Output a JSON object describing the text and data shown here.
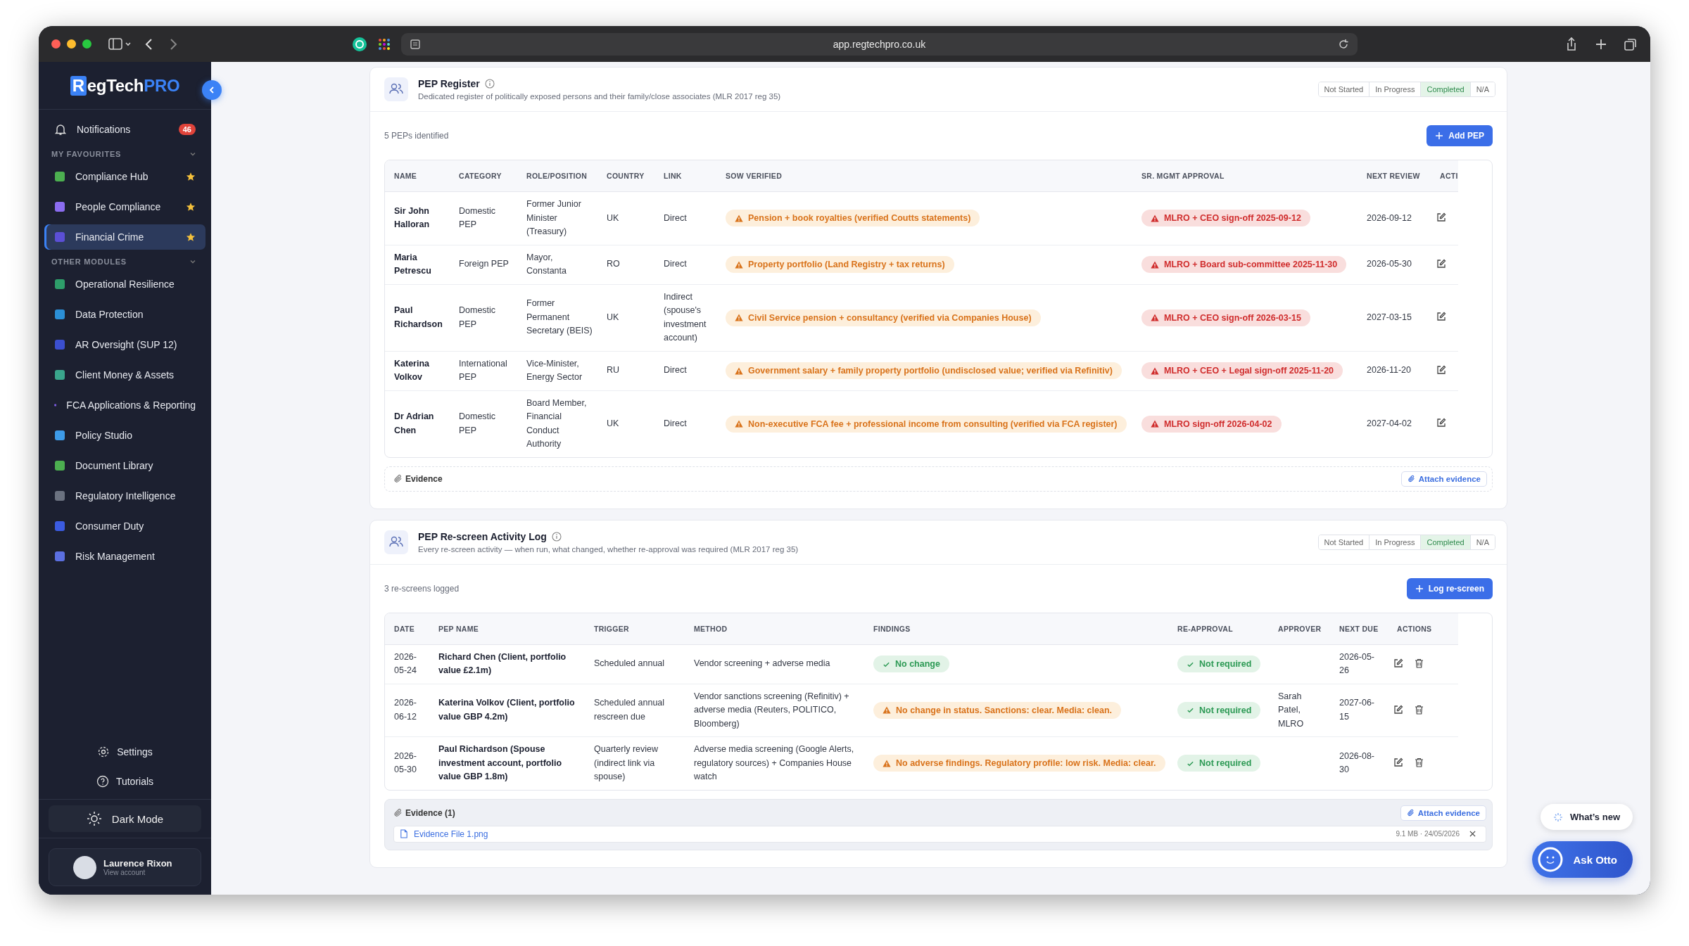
{
  "browser": {
    "url": "app.regtechpro.co.uk"
  },
  "sidebar": {
    "logo": {
      "mark": "R",
      "text": "egTech",
      "accent": "PRO"
    },
    "notifications": {
      "label": "Notifications",
      "count": "46"
    },
    "sections": [
      {
        "title": "MY FAVOURITES",
        "expanded": true,
        "items": [
          {
            "label": "Compliance Hub",
            "color": "#4caf50",
            "starred": true,
            "selected": false
          },
          {
            "label": "People Compliance",
            "color": "#8b6cf0",
            "starred": true,
            "selected": false
          },
          {
            "label": "Financial Crime",
            "color": "#5b4fd6",
            "starred": true,
            "selected": true
          }
        ]
      },
      {
        "title": "OTHER MODULES",
        "expanded": true,
        "items": [
          {
            "label": "Operational Resilience",
            "color": "#2e9e6a",
            "starred": false,
            "selected": false
          },
          {
            "label": "Data Protection",
            "color": "#2b8fd6",
            "starred": false,
            "selected": false
          },
          {
            "label": "AR Oversight (SUP 12)",
            "color": "#3b4fd0",
            "starred": false,
            "selected": false
          },
          {
            "label": "Client Money & Assets",
            "color": "#3aa58c",
            "starred": false,
            "selected": false
          },
          {
            "label": "FCA Applications & Reporting",
            "color": "#7b5be0",
            "starred": false,
            "selected": false
          },
          {
            "label": "Policy Studio",
            "color": "#3d9be9",
            "starred": false,
            "selected": false
          },
          {
            "label": "Document Library",
            "color": "#4caf50",
            "starred": false,
            "selected": false
          },
          {
            "label": "Regulatory Intelligence",
            "color": "#6b7280",
            "starred": false,
            "selected": false
          },
          {
            "label": "Consumer Duty",
            "color": "#3b5be0",
            "starred": false,
            "selected": false
          },
          {
            "label": "Risk Management",
            "color": "#5b6fe0",
            "starred": false,
            "selected": false
          }
        ]
      }
    ],
    "settings": "Settings",
    "tutorials": "Tutorials",
    "dark_mode": "Dark Mode",
    "user": {
      "name": "Laurence Rixon",
      "subtitle": "View account"
    }
  },
  "cards": [
    {
      "title": "PEP Register",
      "description": "Dedicated register of politically exposed persons and their family/close associates (MLR 2017 reg 35)",
      "status_options": [
        {
          "label": "Not Started",
          "selected": false
        },
        {
          "label": "In Progress",
          "selected": false
        },
        {
          "label": "Completed",
          "selected": true
        },
        {
          "label": "N/A",
          "selected": false
        }
      ],
      "count": "5 PEPs identified",
      "add_button": "Add PEP",
      "table": {
        "columns": [
          "NAME",
          "CATEGORY",
          "ROLE/POSITION",
          "COUNTRY",
          "LINK",
          "SOW VERIFIED",
          "SR. MGMT APPROVAL",
          "NEXT REVIEW",
          "ACTI"
        ],
        "rows": [
          {
            "cells": [
              {
                "text": "Sir John Halloran"
              },
              {
                "text": "Domestic PEP"
              },
              {
                "text": "Former Junior Minister (Treasury)"
              },
              {
                "text": "UK"
              },
              {
                "text": "Direct"
              },
              {
                "text": "Pension + book royalties (verified Coutts statements)",
                "kind": "warning"
              },
              {
                "text": "MLRO + CEO sign-off 2025-09-12",
                "kind": "danger"
              },
              {
                "text": "2026-09-12"
              }
            ],
            "actions": [
              {
                "kind": "edit"
              }
            ]
          },
          {
            "cells": [
              {
                "text": "Maria Petrescu"
              },
              {
                "text": "Foreign PEP"
              },
              {
                "text": "Mayor, Constanta"
              },
              {
                "text": "RO"
              },
              {
                "text": "Direct"
              },
              {
                "text": "Property portfolio (Land Registry + tax returns)",
                "kind": "warning"
              },
              {
                "text": "MLRO + Board sub-committee 2025-11-30",
                "kind": "danger"
              },
              {
                "text": "2026-05-30"
              }
            ],
            "actions": [
              {
                "kind": "edit"
              }
            ]
          },
          {
            "cells": [
              {
                "text": "Paul Richardson"
              },
              {
                "text": "Domestic PEP"
              },
              {
                "text": "Former Permanent Secretary (BEIS)"
              },
              {
                "text": "UK"
              },
              {
                "text": "Indirect (spouse's investment account)"
              },
              {
                "text": "Civil Service pension + consultancy (verified via Companies House)",
                "kind": "warning"
              },
              {
                "text": "MLRO + CEO sign-off 2026-03-15",
                "kind": "danger"
              },
              {
                "text": "2027-03-15"
              }
            ],
            "actions": [
              {
                "kind": "edit"
              }
            ]
          },
          {
            "cells": [
              {
                "text": "Katerina Volkov"
              },
              {
                "text": "International PEP"
              },
              {
                "text": "Vice-Minister, Energy Sector"
              },
              {
                "text": "RU"
              },
              {
                "text": "Direct"
              },
              {
                "text": "Government salary + family property portfolio (undisclosed value; verified via Refinitiv)",
                "kind": "warning"
              },
              {
                "text": "MLRO + CEO + Legal sign-off 2025-11-20",
                "kind": "danger"
              },
              {
                "text": "2026-11-20"
              }
            ],
            "actions": [
              {
                "kind": "edit"
              }
            ]
          },
          {
            "cells": [
              {
                "text": "Dr Adrian Chen"
              },
              {
                "text": "Domestic PEP"
              },
              {
                "text": "Board Member, Financial Conduct Authority"
              },
              {
                "text": "UK"
              },
              {
                "text": "Direct"
              },
              {
                "text": "Non-executive FCA fee + professional income from consulting (verified via FCA register)",
                "kind": "warning"
              },
              {
                "text": "MLRO sign-off 2026-04-02",
                "kind": "danger"
              },
              {
                "text": "2027-04-02"
              }
            ],
            "actions": [
              {
                "kind": "edit"
              }
            ]
          }
        ]
      },
      "evidence": {
        "label": "Evidence",
        "attach": "Attach evidence"
      }
    },
    {
      "title": "PEP Re-screen Activity Log",
      "description": "Every re-screen activity — when run, what changed, whether re-approval was required (MLR 2017 reg 35)",
      "status_options": [
        {
          "label": "Not Started",
          "selected": false
        },
        {
          "label": "In Progress",
          "selected": false
        },
        {
          "label": "Completed",
          "selected": true
        },
        {
          "label": "N/A",
          "selected": false
        }
      ],
      "count": "3 re-screens logged",
      "add_button": "Log re-screen",
      "table": {
        "columns": [
          "DATE",
          "PEP NAME",
          "TRIGGER",
          "METHOD",
          "FINDINGS",
          "RE-APPROVAL",
          "APPROVER",
          "NEXT DUE",
          "ACTIONS"
        ],
        "rows": [
          {
            "cells": [
              {
                "text": "2026-05-24"
              },
              {
                "text": "Richard Chen (Client, portfolio value £2.1m)"
              },
              {
                "text": "Scheduled annual"
              },
              {
                "text": "Vendor screening + adverse media"
              },
              {
                "text": "No change",
                "kind": "success"
              },
              {
                "text": "Not required",
                "kind": "success"
              },
              {},
              {
                "text": "2026-05-26"
              }
            ],
            "actions": [
              {
                "kind": "edit"
              },
              {
                "kind": "delete"
              }
            ]
          },
          {
            "cells": [
              {
                "text": "2026-06-12"
              },
              {
                "text": "Katerina Volkov (Client, portfolio value GBP 4.2m)"
              },
              {
                "text": "Scheduled annual rescreen due"
              },
              {
                "text": "Vendor sanctions screening (Refinitiv) + adverse media (Reuters, POLITICO, Bloomberg)"
              },
              {
                "text": "No change in status. Sanctions: clear. Media: clean.",
                "kind": "warning"
              },
              {
                "text": "Not required",
                "kind": "success"
              },
              {
                "text": "Sarah Patel, MLRO"
              },
              {
                "text": "2027-06-15"
              }
            ],
            "actions": [
              {
                "kind": "edit"
              },
              {
                "kind": "delete"
              }
            ]
          },
          {
            "cells": [
              {
                "text": "2026-05-30"
              },
              {
                "text": "Paul Richardson (Spouse investment account, portfolio value GBP 1.8m)"
              },
              {
                "text": "Quarterly review (indirect link via spouse)"
              },
              {
                "text": "Adverse media screening (Google Alerts, regulatory sources) + Companies House watch"
              },
              {
                "text": "No adverse findings. Regulatory profile: low risk. Media: clear.",
                "kind": "warning"
              },
              {
                "text": "Not required",
                "kind": "success"
              },
              {},
              {
                "text": "2026-08-30"
              }
            ],
            "actions": [
              {
                "kind": "edit"
              },
              {
                "kind": "delete"
              }
            ]
          }
        ]
      },
      "evidence": {
        "label": "Evidence (1)",
        "attach": "Attach evidence",
        "files": [
          {
            "name": "Evidence File 1.png",
            "meta": "9.1 MB · 24/05/2026"
          }
        ]
      }
    }
  ],
  "floating": {
    "whats_new": "What’s new",
    "ask": "Ask Otto"
  }
}
